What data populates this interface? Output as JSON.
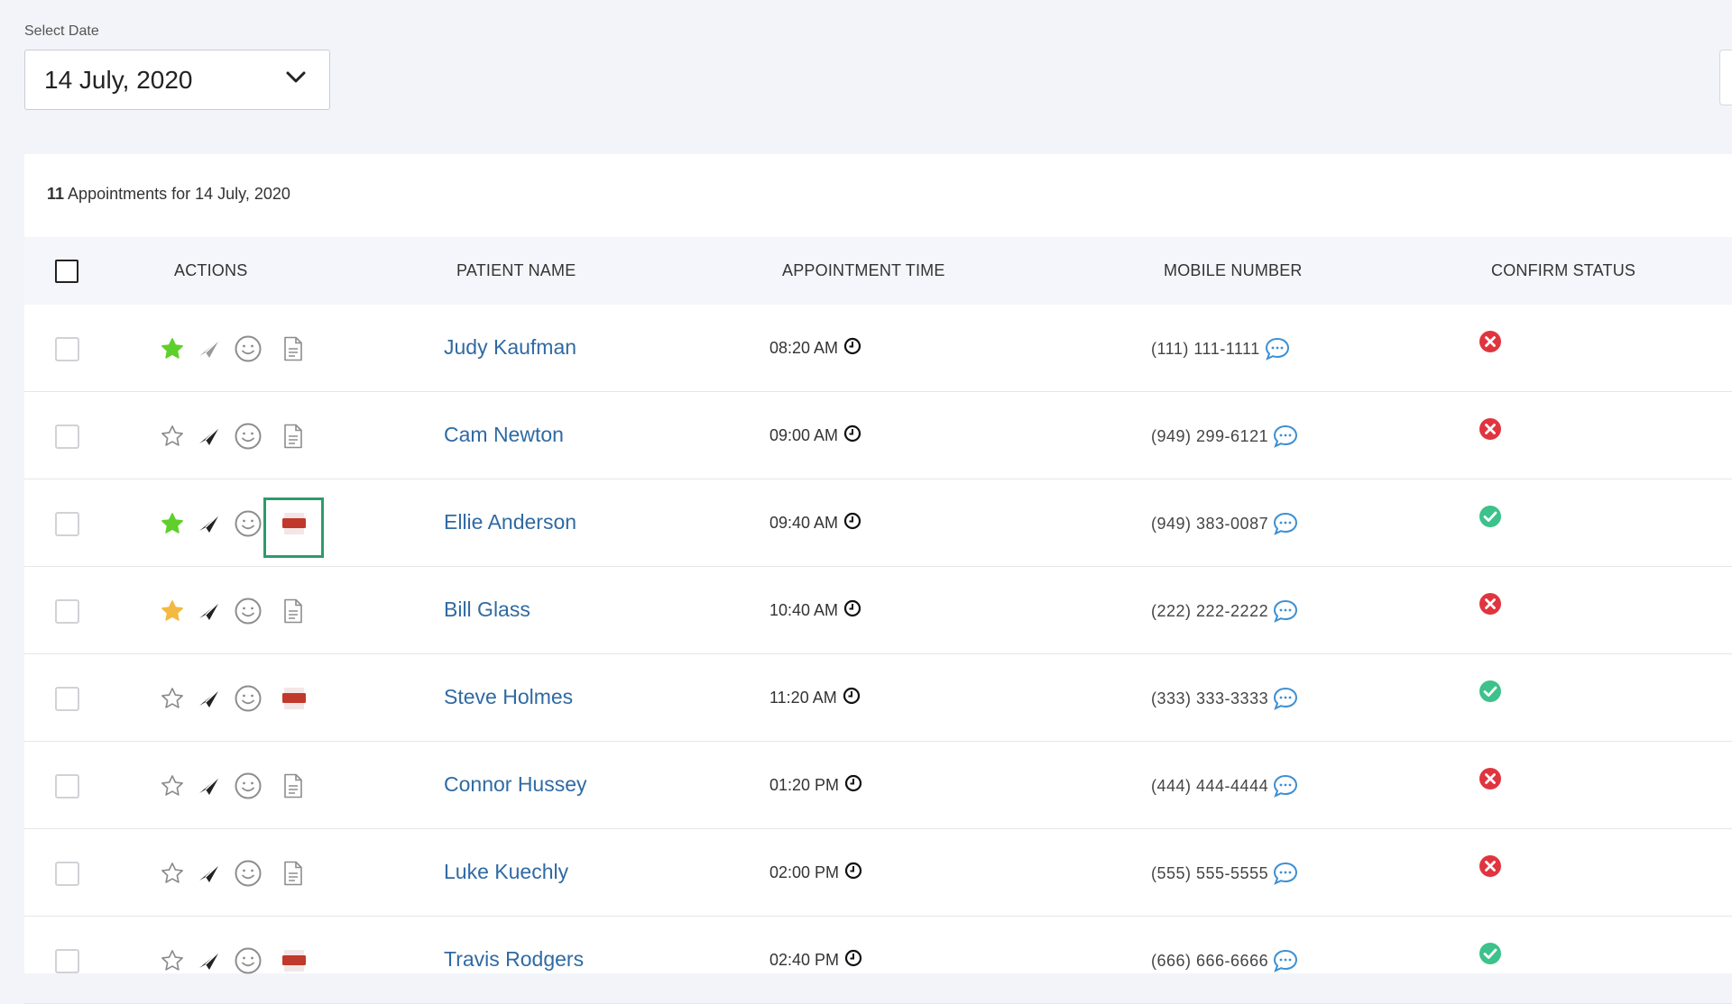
{
  "date_picker": {
    "label": "Select Date",
    "value": "14 July, 2020"
  },
  "summary": {
    "count": "11",
    "text": "Appointments for 14 July, 2020"
  },
  "columns": {
    "actions": "ACTIONS",
    "patient_name": "PATIENT NAME",
    "appointment_time": "APPOINTMENT TIME",
    "mobile_number": "MOBILE NUMBER",
    "confirm_status": "CONFIRM STATUS"
  },
  "colors": {
    "star_green": "#5fcf2c",
    "star_gold": "#f4b942",
    "link_blue": "#2f6aa3",
    "status_red": "#e0353f",
    "status_green": "#3cc28a",
    "pdf_red": "#c0392b",
    "highlight": "#2f9a6a"
  },
  "rows": [
    {
      "name": "Judy Kaufman",
      "time": "08:20 AM",
      "phone": "(111) 111-1111",
      "star": "green",
      "send": "light",
      "doc": "doc-icon",
      "status": "unconfirmed"
    },
    {
      "name": "Cam Newton",
      "time": "09:00 AM",
      "phone": "(949) 299-6121",
      "star": "empty",
      "send": "dark",
      "doc": "doc-icon",
      "status": "unconfirmed"
    },
    {
      "name": "Ellie Anderson",
      "time": "09:40 AM",
      "phone": "(949) 383-0087",
      "star": "green",
      "send": "dark",
      "doc": "pdf-icon",
      "status": "confirmed",
      "pdf_label": "PDF",
      "highlighted": true
    },
    {
      "name": "Bill Glass",
      "time": "10:40 AM",
      "phone": "(222) 222-2222",
      "star": "gold",
      "send": "dark",
      "doc": "doc-icon",
      "status": "unconfirmed"
    },
    {
      "name": "Steve Holmes",
      "time": "11:20 AM",
      "phone": "(333) 333-3333",
      "star": "empty",
      "send": "dark",
      "doc": "pdf-icon",
      "status": "confirmed",
      "pdf_label": "PDF"
    },
    {
      "name": "Connor Hussey",
      "time": "01:20 PM",
      "phone": "(444) 444-4444",
      "star": "empty",
      "send": "dark",
      "doc": "doc-icon",
      "status": "unconfirmed"
    },
    {
      "name": "Luke Kuechly",
      "time": "02:00 PM",
      "phone": "(555) 555-5555",
      "star": "empty",
      "send": "dark",
      "doc": "doc-icon",
      "status": "unconfirmed"
    },
    {
      "name": "Travis Rodgers",
      "time": "02:40 PM",
      "phone": "(666) 666-6666",
      "star": "empty",
      "send": "dark",
      "doc": "pdf-icon",
      "status": "confirmed",
      "pdf_label": "PDF"
    }
  ]
}
